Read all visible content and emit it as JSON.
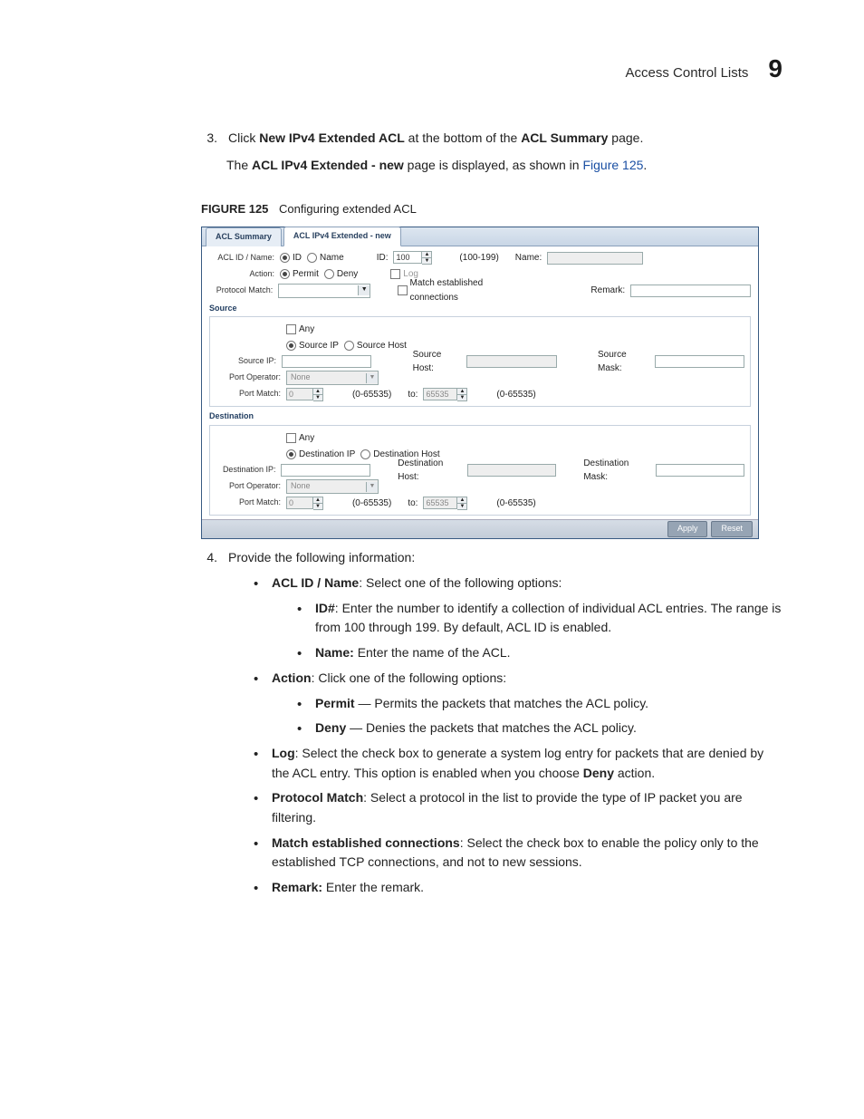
{
  "header": {
    "title": "Access Control Lists",
    "number": "9"
  },
  "steps": {
    "s3": {
      "num": "3.",
      "pre": "Click ",
      "b1": "New IPv4 Extended ACL",
      "mid": " at the bottom of the ",
      "b2": "ACL Summary",
      "post": " page."
    },
    "s3b": {
      "pre": "The ",
      "b1": "ACL IPv4 Extended - new",
      "mid": " page is displayed, as shown in ",
      "link": "Figure 125",
      "post": "."
    }
  },
  "figure": {
    "cap": "FIGURE 125",
    "title": "Configuring extended ACL"
  },
  "shot": {
    "tabs": {
      "summary": "ACL Summary",
      "new": "ACL IPv4 Extended - new"
    },
    "row1": {
      "label": "ACL ID / Name:",
      "rid_id": "ID",
      "rid_name": "Name",
      "id_label": "ID:",
      "id_value": "100",
      "id_range": "(100-199)",
      "name_label": "Name:"
    },
    "row2": {
      "label": "Action:",
      "r_permit": "Permit",
      "r_deny": "Deny",
      "log": "Log"
    },
    "row3": {
      "label": "Protocol Match:",
      "mec": "Match established connections",
      "remark": "Remark:"
    },
    "src": {
      "legend": "Source",
      "any": "Any",
      "r_ip": "Source IP",
      "r_host": "Source Host",
      "ip_label": "Source IP:",
      "host_label": "Source Host:",
      "mask_label": "Source Mask:",
      "portop_label": "Port Operator:",
      "portop_value": "None",
      "portmatch_label": "Port Match:",
      "pm_lo": "0",
      "pm_range": "(0-65535)",
      "pm_to": "to:",
      "pm_hi": "65535",
      "pm_range2": "(0-65535)"
    },
    "dst": {
      "legend": "Destination",
      "any": "Any",
      "r_ip": "Destination IP",
      "r_host": "Destination Host",
      "ip_label": "Destination IP:",
      "host_label": "Destination Host:",
      "mask_label": "Destination Mask:",
      "portop_label": "Port Operator:",
      "portop_value": "None",
      "portmatch_label": "Port Match:",
      "pm_lo": "0",
      "pm_range": "(0-65535)",
      "pm_to": "to:",
      "pm_hi": "65535",
      "pm_range2": "(0-65535)"
    },
    "buttons": {
      "apply": "Apply",
      "reset": "Reset"
    }
  },
  "step4": {
    "num": "4.",
    "text": "Provide the following information:"
  },
  "list": {
    "acl": {
      "b": "ACL ID / Name",
      "rest": ": Select one of the following options:"
    },
    "idnum": {
      "b": "ID#",
      "rest": ": Enter the number to identify a collection of individual ACL entries. The range is from 100 through 199. By default, ACL ID is enabled."
    },
    "name": {
      "b": "Name: ",
      "rest": "Enter the name of the ACL."
    },
    "action": {
      "b": "Action",
      "rest": ": Click one of the following options:"
    },
    "permit": {
      "b": "Permit",
      "rest": " — Permits the packets that matches the ACL policy."
    },
    "deny": {
      "b": "Deny",
      "rest": " — Denies the packets that matches the ACL policy."
    },
    "log": {
      "b": "Log",
      "rest1": ": Select the check box to generate a system log entry for packets that are denied by the ACL entry. This option is enabled when you choose ",
      "b2": "Deny",
      "rest2": " action."
    },
    "protocol": {
      "b": "Protocol Match",
      "rest": ": Select a protocol in the list to provide the type of IP packet you are filtering."
    },
    "mec": {
      "b": "Match established connections",
      "rest": ": Select the check box to enable the policy only to the established TCP connections, and not to new sessions."
    },
    "remark": {
      "b": "Remark: ",
      "rest": "Enter the remark."
    }
  }
}
